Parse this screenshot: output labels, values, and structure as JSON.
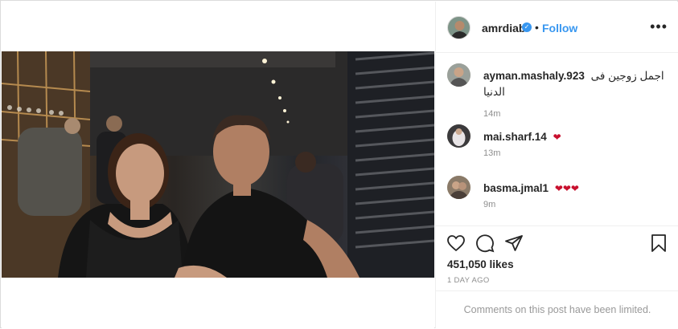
{
  "post": {
    "owner": "amrdiab",
    "verified_mark": "✓",
    "separator": "•",
    "follow_label": "Follow",
    "more_label": "•••"
  },
  "comments": [
    {
      "username": "ayman.mashaly.923",
      "text_line1": "اجمل زوجين فى",
      "text_line2": "الدنيا",
      "time": "14m"
    },
    {
      "username": "mai.sharf.14",
      "text": "❤",
      "time": "13m"
    },
    {
      "username": "basma.jmal1",
      "text": "❤❤❤",
      "time": "9m"
    }
  ],
  "actions": {
    "icons": [
      "heart-icon",
      "comment-icon",
      "share-icon",
      "bookmark-icon"
    ],
    "likes": "451,050 likes",
    "date": "1 DAY AGO",
    "limited_notice": "Comments on this post have been limited."
  },
  "colors": {
    "link": "#3897f0",
    "heart": "#c8102e",
    "muted": "#8e8e8e",
    "border": "#efefef"
  }
}
